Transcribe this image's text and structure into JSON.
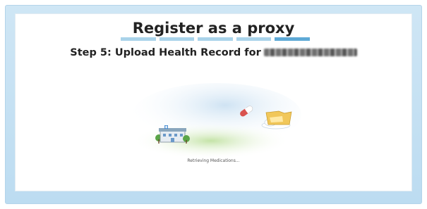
{
  "dialog": {
    "title": "Register as a proxy",
    "step_label": "Step 5: Upload Health Record for",
    "progress": {
      "total_steps": 5,
      "current_step": 5
    },
    "status_text": "Retrieving Medications..."
  },
  "colors": {
    "frame_bg": "#c6e2f4",
    "progress_segment": "#a9d3ea",
    "progress_active": "#5ea9d6",
    "text": "#222222"
  },
  "icons": [
    "hospital-icon",
    "pill-icon",
    "cloud-icon",
    "folder-icon"
  ]
}
